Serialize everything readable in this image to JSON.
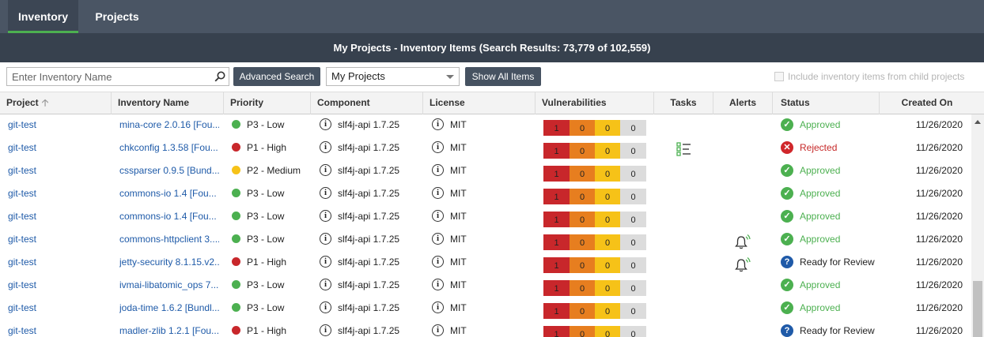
{
  "nav": {
    "tabs": [
      {
        "label": "Inventory"
      },
      {
        "label": "Projects"
      }
    ]
  },
  "title": "My Projects - Inventory Items (Search Results: 73,779 of 102,559)",
  "toolbar": {
    "search_placeholder": "Enter Inventory Name",
    "advanced_search_label": "Advanced Search",
    "project_select_value": "My Projects",
    "show_all_label": "Show All Items",
    "include_child_label": "Include inventory items from child projects"
  },
  "columns": {
    "project": "Project",
    "inventory_name": "Inventory Name",
    "priority": "Priority",
    "component": "Component",
    "license": "License",
    "vulnerabilities": "Vulnerabilities",
    "tasks": "Tasks",
    "alerts": "Alerts",
    "status": "Status",
    "created_on": "Created On"
  },
  "colors": {
    "p1_high": "#c8272b",
    "p2_medium": "#f6c218",
    "p3_low": "#4cb050",
    "approved": "#4cb050",
    "rejected": "#d0272b",
    "review": "#1f5aa8",
    "vul_critical": "#c8272b",
    "vul_high": "#e77e1f",
    "vul_medium": "#f6c218",
    "vul_low": "#dcdcdc"
  },
  "rows": [
    {
      "project": "git-test",
      "inventory": "mina-core 2.0.16  [Fou...",
      "priority": "P3 - Low",
      "priority_level": "low",
      "component": "slf4j-api 1.7.25",
      "license": "MIT",
      "vul": [
        "1",
        "0",
        "0",
        "0"
      ],
      "task": false,
      "alert": false,
      "status": "Approved",
      "status_kind": "ok",
      "date": "11/26/2020"
    },
    {
      "project": "git-test",
      "inventory": "chkconfig 1.3.58  [Fou...",
      "priority": "P1 - High",
      "priority_level": "high",
      "component": "slf4j-api 1.7.25",
      "license": "MIT",
      "vul": [
        "1",
        "0",
        "0",
        "0"
      ],
      "task": true,
      "alert": false,
      "status": "Rejected",
      "status_kind": "rej",
      "date": "11/26/2020"
    },
    {
      "project": "git-test",
      "inventory": "cssparser 0.9.5  [Bund...",
      "priority": "P2 - Medium",
      "priority_level": "medium",
      "component": "slf4j-api 1.7.25",
      "license": "MIT",
      "vul": [
        "1",
        "0",
        "0",
        "0"
      ],
      "task": false,
      "alert": false,
      "status": "Approved",
      "status_kind": "ok",
      "date": "11/26/2020"
    },
    {
      "project": "git-test",
      "inventory": "commons-io 1.4  [Fou...",
      "priority": "P3 - Low",
      "priority_level": "low",
      "component": "slf4j-api 1.7.25",
      "license": "MIT",
      "vul": [
        "1",
        "0",
        "0",
        "0"
      ],
      "task": false,
      "alert": false,
      "status": "Approved",
      "status_kind": "ok",
      "date": "11/26/2020"
    },
    {
      "project": "git-test",
      "inventory": "commons-io 1.4  [Fou...",
      "priority": "P3 - Low",
      "priority_level": "low",
      "component": "slf4j-api 1.7.25",
      "license": "MIT",
      "vul": [
        "1",
        "0",
        "0",
        "0"
      ],
      "task": false,
      "alert": false,
      "status": "Approved",
      "status_kind": "ok",
      "date": "11/26/2020"
    },
    {
      "project": "git-test",
      "inventory": "commons-httpclient 3....",
      "priority": "P3 - Low",
      "priority_level": "low",
      "component": "slf4j-api 1.7.25",
      "license": "MIT",
      "vul": [
        "1",
        "0",
        "0",
        "0"
      ],
      "task": false,
      "alert": true,
      "status": "Approved",
      "status_kind": "ok",
      "date": "11/26/2020"
    },
    {
      "project": "git-test",
      "inventory": "jetty-security 8.1.15.v2...",
      "priority": "P1 - High",
      "priority_level": "high",
      "component": "slf4j-api 1.7.25",
      "license": "MIT",
      "vul": [
        "1",
        "0",
        "0",
        "0"
      ],
      "task": false,
      "alert": true,
      "status": "Ready for Review",
      "status_kind": "rev",
      "date": "11/26/2020"
    },
    {
      "project": "git-test",
      "inventory": "ivmai-libatomic_ops 7....",
      "priority": "P3 - Low",
      "priority_level": "low",
      "component": "slf4j-api 1.7.25",
      "license": "MIT",
      "vul": [
        "1",
        "0",
        "0",
        "0"
      ],
      "task": false,
      "alert": false,
      "status": "Approved",
      "status_kind": "ok",
      "date": "11/26/2020"
    },
    {
      "project": "git-test",
      "inventory": "joda-time 1.6.2  [Bundl...",
      "priority": "P3 - Low",
      "priority_level": "low",
      "component": "slf4j-api 1.7.25",
      "license": "MIT",
      "vul": [
        "1",
        "0",
        "0",
        "0"
      ],
      "task": false,
      "alert": false,
      "status": "Approved",
      "status_kind": "ok",
      "date": "11/26/2020"
    },
    {
      "project": "git-test",
      "inventory": "madler-zlib 1.2.1  [Fou...",
      "priority": "P1 - High",
      "priority_level": "high",
      "component": "slf4j-api 1.7.25",
      "license": "MIT",
      "vul": [
        "1",
        "0",
        "0",
        "0"
      ],
      "task": false,
      "alert": false,
      "status": "Ready for Review",
      "status_kind": "rev",
      "date": "11/26/2020"
    }
  ]
}
